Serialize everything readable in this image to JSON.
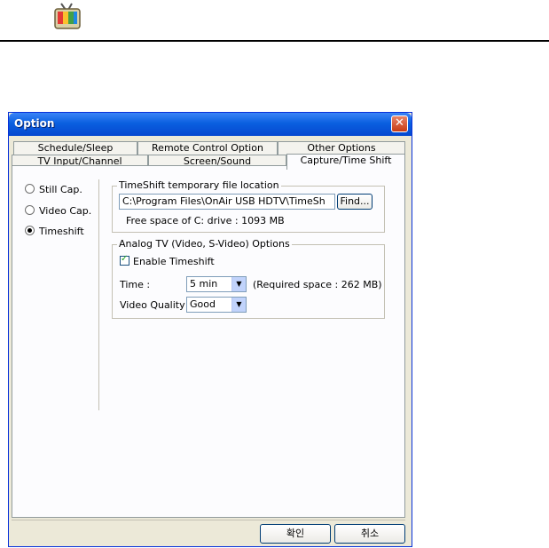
{
  "dialog": {
    "title": "Option",
    "close_label": "✕"
  },
  "tabs": {
    "row1": [
      "Schedule/Sleep",
      "Remote Control Option",
      "Other Options"
    ],
    "row2": [
      "TV Input/Channel",
      "Screen/Sound",
      "Capture/Time Shift"
    ],
    "active": "Capture/Time Shift"
  },
  "modes": [
    {
      "label": "Still Cap.",
      "selected": false
    },
    {
      "label": "Video Cap.",
      "selected": false
    },
    {
      "label": "Timeshift",
      "selected": true
    }
  ],
  "timeshift_location": {
    "group_title": "TimeShift temporary file location",
    "path_value": "C:\\Program Files\\OnAir USB HDTV\\TimeSh",
    "find_label": "Find...",
    "free_space": "Free space of C: drive : 1093 MB"
  },
  "analog_options": {
    "group_title": "Analog TV (Video, S-Video) Options",
    "enable_label": "Enable Timeshift",
    "enable_checked": true,
    "time_label": "Time :",
    "time_value": "5 min",
    "required_space": "(Required space : 262 MB)",
    "quality_label": "Video Quality :",
    "quality_value": "Good"
  },
  "buttons": {
    "ok": "확인",
    "cancel": "취소"
  }
}
